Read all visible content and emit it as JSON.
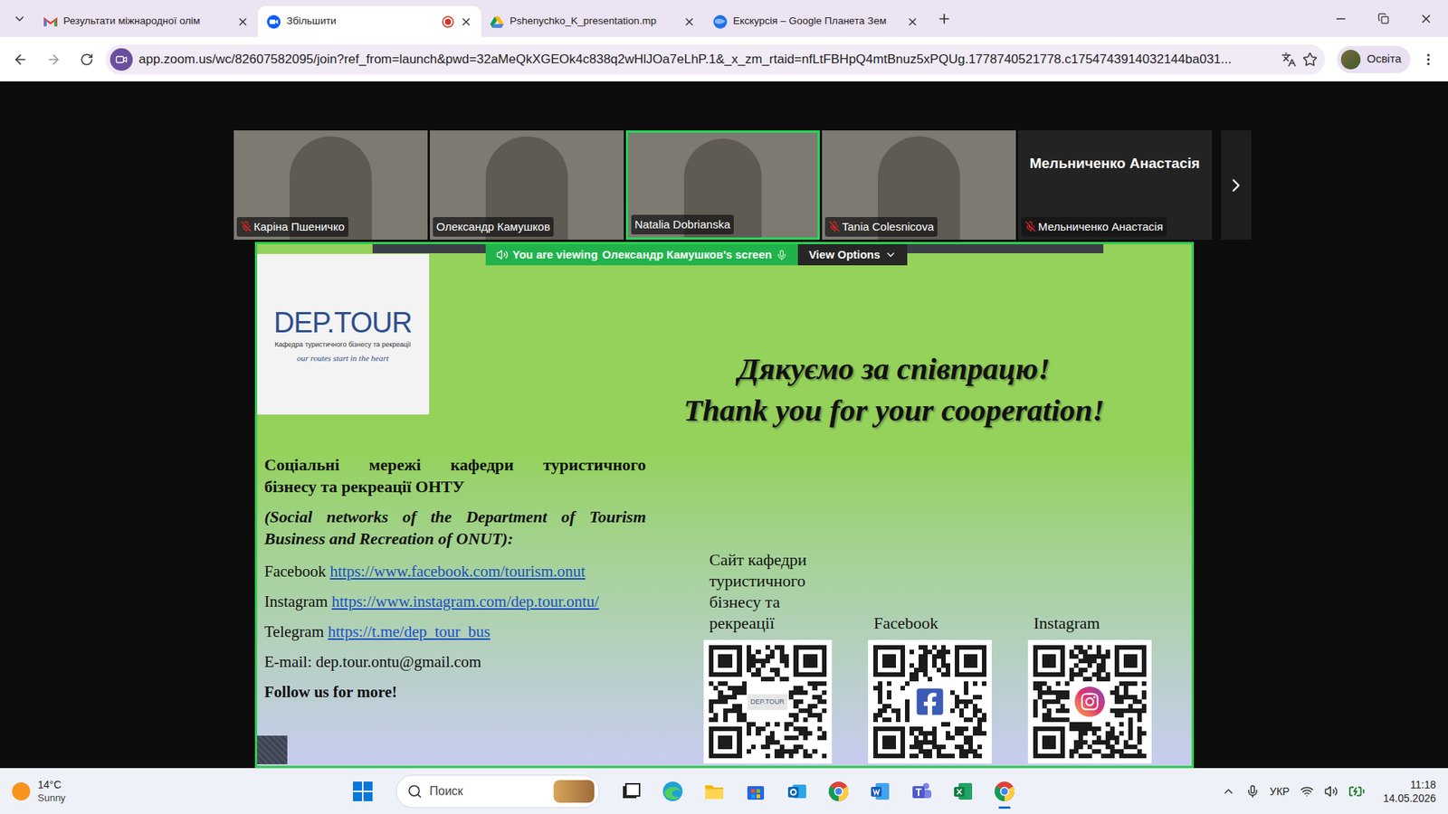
{
  "browser": {
    "tabs": [
      {
        "title": "Результати міжнародної олім",
        "icon": "gmail",
        "selected": false,
        "recording": false
      },
      {
        "title": "Збільшити",
        "icon": "zoom",
        "selected": true,
        "recording": true
      },
      {
        "title": "Pshenychko_K_presentation.mp",
        "icon": "drive",
        "selected": false,
        "recording": false
      },
      {
        "title": "Екскурсія – Google Планета Зем",
        "icon": "earth",
        "selected": false,
        "recording": false
      }
    ],
    "url": "app.zoom.us/wc/82607582095/join?ref_from=launch&pwd=32aMeQkXGEOk4c838q2wHlJOa7eLhP.1&_x_zm_rtaid=nfLtFBHpQ4mtBnuz5xPQUg.1778740521778.c1754743914032144ba031...",
    "profile": "Освіта",
    "bookmarked": false
  },
  "meeting": {
    "participants": [
      {
        "name": "Каріна Пшеничко",
        "kind": "video",
        "muted": true,
        "speaking": false
      },
      {
        "name": "Олександр Камушков",
        "kind": "video",
        "muted": false,
        "speaking": false
      },
      {
        "name": "Natalia Dobrianska",
        "kind": "video",
        "muted": false,
        "speaking": true
      },
      {
        "name": "Tania Colesnicova",
        "kind": "video",
        "muted": true,
        "speaking": false
      },
      {
        "name": "Мельниченко Анастасія",
        "kind": "name-only",
        "muted": true,
        "speaking": false
      }
    ],
    "banner": {
      "prefix": "You are viewing",
      "presenter": "Олександр Камушков's screen",
      "options": "View Options"
    }
  },
  "slide": {
    "logo": {
      "title": "DEP.TOUR",
      "subtitle": "Кафедра туристичного бізнесу та рекреації",
      "motto": "our routes start in the heart"
    },
    "thanks": [
      "Дякуємо за співпрацю!",
      "Thank you for your cooperation!"
    ],
    "heading_lines": [
      "Соціальні мережі кафедри туристичного",
      "бізнесу та рекреації ОНТУ"
    ],
    "subheading_lines": [
      "(Social networks of the Department of Tourism",
      "Business and Recreation of ONUT):"
    ],
    "contacts": [
      {
        "label": "Facebook",
        "value": "https://www.facebook.com/tourism.onut",
        "link": true
      },
      {
        "label": "Instagram",
        "value": "https://www.instagram.com/dep.tour.ontu/",
        "link": true
      },
      {
        "label": "Telegram",
        "value": "https://t.me/dep_tour_bus",
        "link": true
      },
      {
        "label": "E-mail:",
        "value": "dep.tour.ontu@gmail.com",
        "link": false
      }
    ],
    "follow": "Follow us for more!",
    "qr_codes": [
      {
        "caption_lines": [
          "Сайт кафедри",
          "туристичного",
          "бізнесу та",
          "рекреації"
        ],
        "kind": "site",
        "center": "DEP.TOUR"
      },
      {
        "caption_lines": [
          "Facebook"
        ],
        "kind": "facebook",
        "center": ""
      },
      {
        "caption_lines": [
          "Instagram"
        ],
        "kind": "instagram",
        "center": ""
      }
    ]
  },
  "taskbar": {
    "weather": {
      "temp": "14°C",
      "condition": "Sunny"
    },
    "search": {
      "placeholder": "Поиск"
    },
    "apps": [
      {
        "kind": "task-view",
        "active": false
      },
      {
        "kind": "edge",
        "active": false
      },
      {
        "kind": "explorer",
        "active": false
      },
      {
        "kind": "store",
        "active": false
      },
      {
        "kind": "outlook",
        "active": false
      },
      {
        "kind": "chrome",
        "active": false
      },
      {
        "kind": "word",
        "active": false
      },
      {
        "kind": "teams",
        "active": false
      },
      {
        "kind": "excel",
        "active": false
      },
      {
        "kind": "chrome",
        "active": true
      }
    ],
    "tray": {
      "language": "УКР",
      "time": "11:18",
      "date": "14.05.2026"
    }
  }
}
